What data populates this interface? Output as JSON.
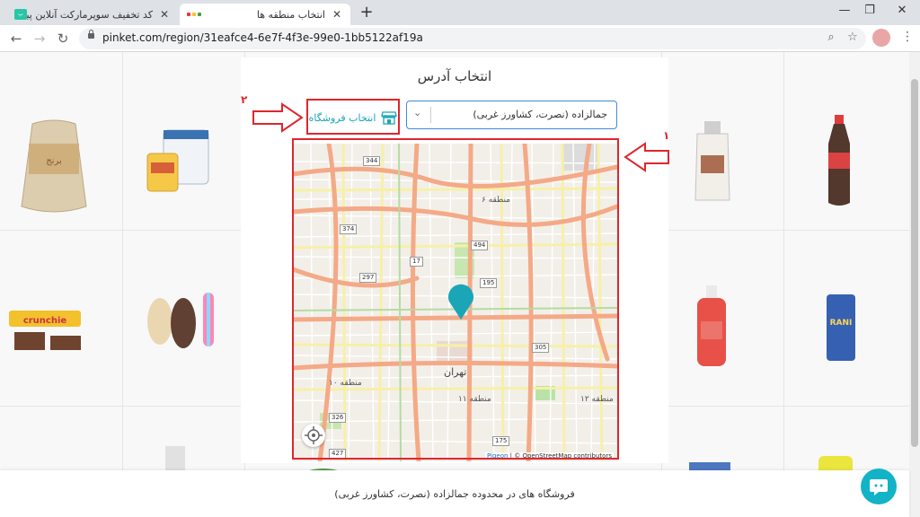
{
  "browser": {
    "tabs": [
      {
        "title": "کد تخفیف سوپرمارکت آنلاین پینکت",
        "active": false
      },
      {
        "title": "انتخاب منطقه ها",
        "active": true
      }
    ],
    "url": "pinket.com/region/31eafce4-6e7f-4f3e-99e0-1bb5122af19a",
    "icons": [
      "back-icon",
      "forward-icon",
      "reload-icon",
      "lock-icon",
      "zoom-icon",
      "star-icon",
      "menu-icon"
    ]
  },
  "modal": {
    "title": "انتخاب آدرس",
    "select_value": "جمالزاده (نصرت، کشاورز غربی)",
    "store_button_label": "انتخاب فروشگاه",
    "map": {
      "labels": {
        "district6": "منطقه ۶",
        "tehran": "تهران",
        "district11": "منطقه ۱۱",
        "district12": "منطقه ۱۲",
        "district10": "منطقه ۱۰"
      },
      "road_numbers": [
        "344",
        "374",
        "17",
        "494",
        "297",
        "195",
        "305",
        "326",
        "427",
        "175"
      ],
      "attribution_pigeon": "Pigeon",
      "attribution_rest": " | © OpenStreetMap contributors"
    }
  },
  "annotations": {
    "label_1": "۱",
    "label_2": "۲"
  },
  "footer": {
    "text": "فروشگاه های در محدوده جمالزاده (نصرت، کشاورز غربی)"
  },
  "colors": {
    "accent": "#1aa6b7",
    "annotation": "#e0262d",
    "select_border": "#3d8bd8",
    "map_pin": "#1aa6b7"
  }
}
